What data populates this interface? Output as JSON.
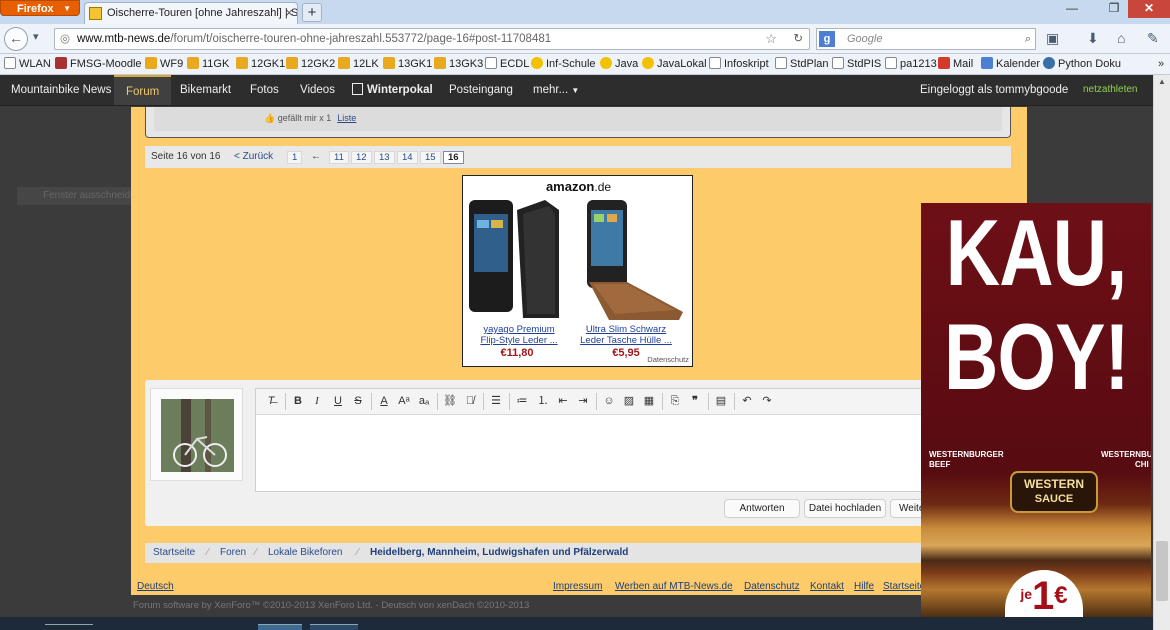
{
  "browser": {
    "menu_button": "Firefox",
    "tab_title": "Oischerre-Touren [ohne Jahreszahl] | Sei...",
    "new_tab_label": "+",
    "url_domain": "www.mtb-news.de",
    "url_path": "/forum/t/oischerre-touren-ohne-jahreszahl.553772/page-16#post-11708481",
    "search_placeholder": "Google",
    "bookmarks": [
      "WLAN",
      "FMSG-Moodle",
      "WF9",
      "11GK",
      "12GK1",
      "12GK2",
      "12LK",
      "13GK1",
      "13GK3",
      "ECDL",
      "Inf-Schule",
      "Java",
      "JavaLokal",
      "Infoskript",
      "StdPlan",
      "StdPIS",
      "pa1213",
      "Mail",
      "Kalender",
      "Python Doku"
    ]
  },
  "site_nav": {
    "items": [
      "Mountainbike News",
      "Forum",
      "Bikemarkt",
      "Fotos",
      "Videos",
      "Winterpokal",
      "Posteingang",
      "mehr..."
    ],
    "active": "Forum",
    "logged_in": "Eingeloggt als tommybgoode",
    "brand": "netzathleten"
  },
  "ghost_label": "Fenster ausschneiden",
  "post_like": {
    "text": "gefällt mir x 1",
    "link": "Liste"
  },
  "pagination": {
    "label": "Seite 16 von 16",
    "back": "< Zurück",
    "first": "1",
    "ellipsis": "←",
    "pages": [
      "11",
      "12",
      "13",
      "14",
      "15",
      "16"
    ],
    "current": "16"
  },
  "amazon_ad": {
    "logo": "amazon",
    "logo_suffix": ".de",
    "products": [
      {
        "title1": "yayago Premium",
        "title2": "Flip-Style Leder ...",
        "price": "€11,80"
      },
      {
        "title1": "Ultra Slim Schwarz",
        "title2": "Leder Tasche Hülle ...",
        "price": "€5,95"
      }
    ],
    "privacy": "Datenschutz"
  },
  "editor": {
    "buttons": [
      "Antworten",
      "Datei hochladen",
      "Weite"
    ]
  },
  "breadcrumb": [
    "Startseite",
    "Foren",
    "Lokale Bikeforen",
    "Heidelberg, Mannheim, Ludwigshafen und Pfälzerwald"
  ],
  "footer": {
    "language": "Deutsch",
    "links": [
      "Impressum",
      "Werben auf MTB-News.de",
      "Datenschutz",
      "Kontakt",
      "Hilfe",
      "Startseite"
    ],
    "copyright": "Forum software by XenForo™ ©2010-2013 XenForo Ltd. - Deutsch von xenDach ©2010-2013"
  },
  "burger_ad": {
    "headline1": "KAU,",
    "headline2": "BOY!",
    "label_left1": "WESTERNBURGER",
    "label_left2": "BEEF",
    "label_right1": "WESTERNBUR",
    "label_right2": "CHI",
    "sauce_small": "WESTERN",
    "sauce_big": "SAUCE",
    "price_prefix": "je",
    "price_num": "1",
    "price_currency": "€"
  },
  "colors": {
    "forum_bg": "#fdcb6a",
    "site_nav_bg": "#2d2d2d",
    "active_nav": "#f3c86a",
    "ad_red": "#6e0f16"
  }
}
